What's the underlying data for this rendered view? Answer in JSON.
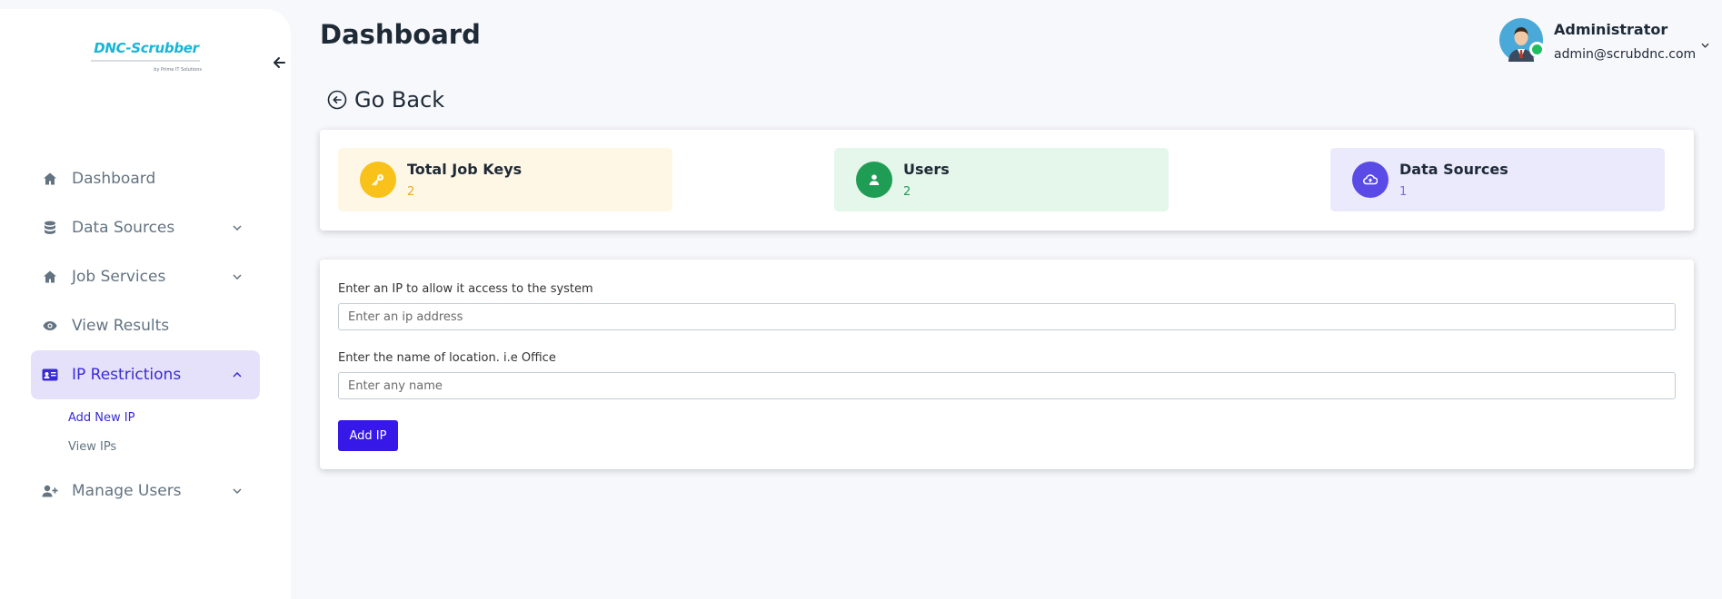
{
  "logo": {
    "title": "DNC-Scrubber",
    "subtitle": "by Prime IT Solutions"
  },
  "sidebar": {
    "items": [
      {
        "label": "Dashboard"
      },
      {
        "label": "Data Sources"
      },
      {
        "label": "Job Services"
      },
      {
        "label": "View Results"
      },
      {
        "label": "IP Restrictions"
      },
      {
        "label": "Manage Users"
      }
    ],
    "sub_items": [
      {
        "label": "Add New IP"
      },
      {
        "label": "View IPs"
      }
    ]
  },
  "header": {
    "title": "Dashboard"
  },
  "user": {
    "name": "Administrator",
    "email": "admin@scrubdnc.com"
  },
  "go_back": {
    "label": "Go Back"
  },
  "stats": [
    {
      "title": "Total Job Keys",
      "value": "2",
      "color": "#f5a623"
    },
    {
      "title": "Users",
      "value": "2",
      "color": "#1f9d55"
    },
    {
      "title": "Data Sources",
      "value": "1",
      "color": "#5b4be6"
    }
  ],
  "form": {
    "ip_label": "Enter an IP to allow it access to the system",
    "ip_placeholder": "Enter an ip address",
    "name_label": "Enter the name of location. i.e Office",
    "name_placeholder": "Enter any name",
    "submit_label": "Add IP"
  },
  "colors": {
    "accent": "#3618e8",
    "active_bg": "#e5e1fb",
    "logo": "#19b5d6"
  }
}
